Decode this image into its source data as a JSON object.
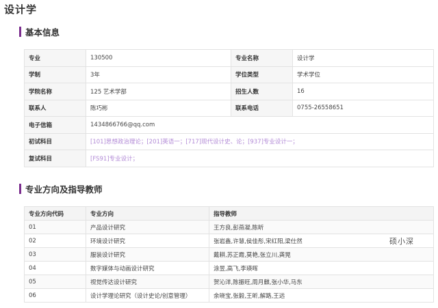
{
  "page": {
    "title": "设计学"
  },
  "basic_info": {
    "heading": "基本信息",
    "rows": [
      {
        "l1": "专业",
        "v1": "130500",
        "l2": "专业名称",
        "v2": "设计学"
      },
      {
        "l1": "学制",
        "v1": "3年",
        "l2": "学位类型",
        "v2": "学术学位"
      },
      {
        "l1": "学院名称",
        "v1": "125 艺术学部",
        "l2": "招生人数",
        "v2": "16"
      },
      {
        "l1": "联系人",
        "v1": "陈巧彬",
        "l2": "联系电话",
        "v2": "0755-26558651"
      }
    ],
    "email": {
      "label": "电子信箱",
      "value": "1434866766@qq.com"
    },
    "first_exam": {
      "label": "初试科目",
      "value": "[101]思想政治理论；[201]英语一；[717]现代设计史、论；[937]专业设计一；"
    },
    "second_exam": {
      "label": "复试科目",
      "value": "[FS91]专业设计；"
    }
  },
  "directions": {
    "heading": "专业方向及指导教师",
    "columns": [
      "专业方向代码",
      "专业方向",
      "指导教师"
    ],
    "rows": [
      {
        "code": "01",
        "name": "产品设计研究",
        "advisors": "王方良,彭燕凝,陈昕"
      },
      {
        "code": "02",
        "name": "环境设计研究",
        "advisors": "张岩鑫,许慧,侯佳彤,宋红阳,梁仕然"
      },
      {
        "code": "03",
        "name": "服装设计研究",
        "advisors": "戴耕,苏正霞,莫艳,张立川,龚晃"
      },
      {
        "code": "04",
        "name": "数字媒体与动画设计研究",
        "advisors": "涂昱,高飞,李瑛晖"
      },
      {
        "code": "05",
        "name": "视觉传达设计研究",
        "advisors": "贺沁洋,陈振旺,周月麒,张小华,马东"
      },
      {
        "code": "06",
        "name": "设计学理论研究（设计史论/创意管理）",
        "advisors": "余晓宝,张毅,王昕,解路,王远"
      }
    ]
  },
  "watermark": "硕小深"
}
